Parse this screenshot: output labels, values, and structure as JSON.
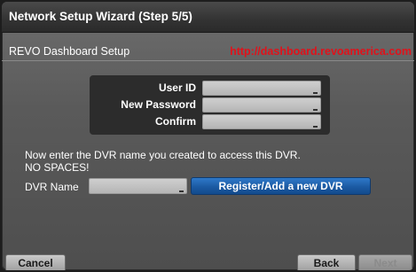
{
  "window": {
    "title": "Network Setup Wizard (Step 5/5)"
  },
  "header": {
    "label": "REVO Dashboard Setup",
    "url": "http://dashboard.revoamerica.com",
    "url_color": "#e0121b"
  },
  "form": {
    "user_id_label": "User ID",
    "user_id_value": "",
    "new_password_label": "New Password",
    "new_password_value": "",
    "confirm_label": "Confirm",
    "confirm_value": ""
  },
  "info": {
    "line1": "Now enter the DVR name you created to access this DVR.",
    "line2": "NO SPACES!"
  },
  "dvr": {
    "name_label": "DVR Name",
    "name_value": "",
    "register_label": "Register/Add a new DVR"
  },
  "buttons": {
    "cancel": "Cancel",
    "back": "Back",
    "next": "Next"
  },
  "colors": {
    "accent_button": "#1b5aa3"
  }
}
